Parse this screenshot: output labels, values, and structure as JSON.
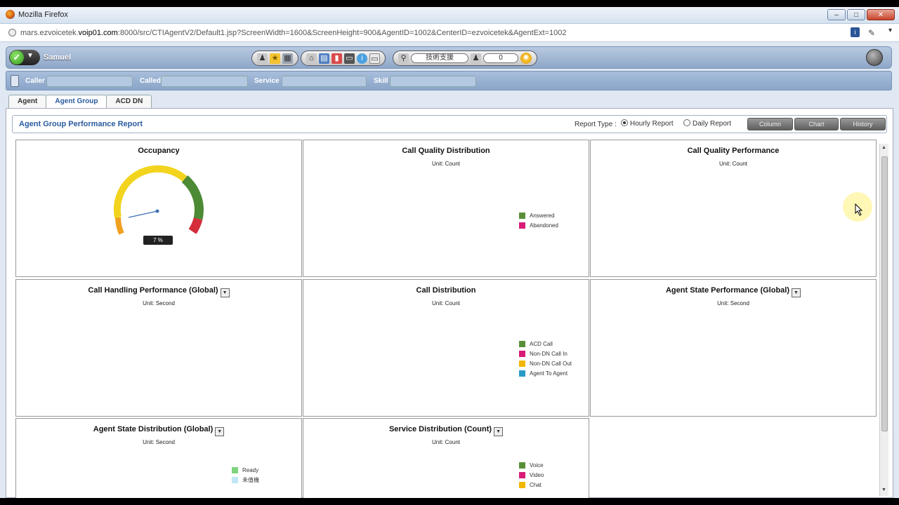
{
  "window": {
    "title": "Mozilla Firefox",
    "min": "–",
    "max": "□",
    "close": "✕"
  },
  "browser": {
    "url_prefix": "mars.ezvoicetek.",
    "url_domain": "voip01.com",
    "url_rest": ":8000/src/CTIAgentV2/Default1.jsp?ScreenWidth=1600&ScreenHeight=900&AgentID=1002&CenterID=ezvoicetek&AgentExt=1002"
  },
  "agent_bar": {
    "agent_name": "Samuel",
    "group_label": "技術支援",
    "queue_count": "0",
    "status_color": "#2f9a1a"
  },
  "call_bar": {
    "caller_label": "Caller",
    "called_label": "Called",
    "service_label": "Service",
    "skill_label": "Skill"
  },
  "tabs": [
    "Agent",
    "Agent Group",
    "ACD DN"
  ],
  "report": {
    "title": "Agent Group Performance Report",
    "type_label": "Report Type :",
    "hourly_label": "Hourly Report",
    "daily_label": "Daily Report",
    "view_buttons": [
      "Column",
      "Chart",
      "History"
    ]
  },
  "panels": {
    "occupancy": {
      "title": "Occupancy",
      "value_text": "7 %",
      "value": 7
    },
    "call_quality_distribution": {
      "title": "Call Quality Distribution",
      "unit": "Unit: Count",
      "legend": [
        {
          "label": "Answered",
          "color": "#5a8f3a"
        },
        {
          "label": "Abandoned",
          "color": "#d81b77"
        }
      ]
    },
    "call_quality_performance": {
      "title": "Call Quality Performance",
      "unit": "Unit: Count"
    },
    "call_handling_performance": {
      "title": "Call Handling Performance (Global)",
      "unit": "Unit: Second"
    },
    "call_distribution": {
      "title": "Call Distribution",
      "unit": "Unit: Count",
      "legend": [
        {
          "label": "ACD Call",
          "color": "#5a8f3a"
        },
        {
          "label": "Non-DN Call In",
          "color": "#d81b77"
        },
        {
          "label": "Non-DN Call Out",
          "color": "#f2b705"
        },
        {
          "label": "Agent To Agent",
          "color": "#2b9ac9"
        }
      ]
    },
    "agent_state_performance": {
      "title": "Agent State Performance (Global)",
      "unit": "Unit: Second"
    },
    "agent_state_distribution": {
      "title": "Agent State Distribution (Global)",
      "unit": "Unit: Second",
      "legend": [
        {
          "label": "Ready",
          "color": "#7fd37f"
        },
        {
          "label": "未值機",
          "color": "#bfe7f5"
        }
      ]
    },
    "service_distribution": {
      "title": "Service Distribution (Count)",
      "unit": "Unit: Count",
      "legend": [
        {
          "label": "Voice",
          "color": "#5a8f3a"
        },
        {
          "label": "Video",
          "color": "#d81b77"
        },
        {
          "label": "Chat",
          "color": "#f2b705"
        }
      ]
    }
  }
}
